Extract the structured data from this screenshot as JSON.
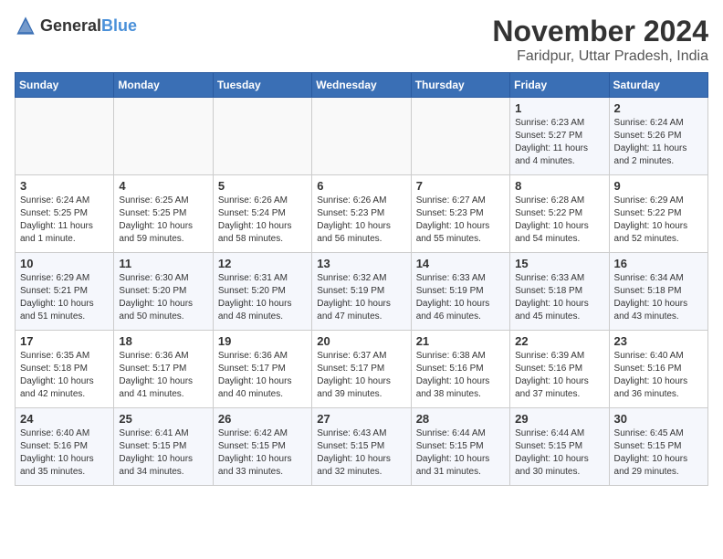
{
  "header": {
    "logo_general": "General",
    "logo_blue": "Blue",
    "month_title": "November 2024",
    "subtitle": "Faridpur, Uttar Pradesh, India"
  },
  "days_of_week": [
    "Sunday",
    "Monday",
    "Tuesday",
    "Wednesday",
    "Thursday",
    "Friday",
    "Saturday"
  ],
  "weeks": [
    [
      {
        "day": "",
        "info": ""
      },
      {
        "day": "",
        "info": ""
      },
      {
        "day": "",
        "info": ""
      },
      {
        "day": "",
        "info": ""
      },
      {
        "day": "",
        "info": ""
      },
      {
        "day": "1",
        "info": "Sunrise: 6:23 AM\nSunset: 5:27 PM\nDaylight: 11 hours and 4 minutes."
      },
      {
        "day": "2",
        "info": "Sunrise: 6:24 AM\nSunset: 5:26 PM\nDaylight: 11 hours and 2 minutes."
      }
    ],
    [
      {
        "day": "3",
        "info": "Sunrise: 6:24 AM\nSunset: 5:25 PM\nDaylight: 11 hours and 1 minute."
      },
      {
        "day": "4",
        "info": "Sunrise: 6:25 AM\nSunset: 5:25 PM\nDaylight: 10 hours and 59 minutes."
      },
      {
        "day": "5",
        "info": "Sunrise: 6:26 AM\nSunset: 5:24 PM\nDaylight: 10 hours and 58 minutes."
      },
      {
        "day": "6",
        "info": "Sunrise: 6:26 AM\nSunset: 5:23 PM\nDaylight: 10 hours and 56 minutes."
      },
      {
        "day": "7",
        "info": "Sunrise: 6:27 AM\nSunset: 5:23 PM\nDaylight: 10 hours and 55 minutes."
      },
      {
        "day": "8",
        "info": "Sunrise: 6:28 AM\nSunset: 5:22 PM\nDaylight: 10 hours and 54 minutes."
      },
      {
        "day": "9",
        "info": "Sunrise: 6:29 AM\nSunset: 5:22 PM\nDaylight: 10 hours and 52 minutes."
      }
    ],
    [
      {
        "day": "10",
        "info": "Sunrise: 6:29 AM\nSunset: 5:21 PM\nDaylight: 10 hours and 51 minutes."
      },
      {
        "day": "11",
        "info": "Sunrise: 6:30 AM\nSunset: 5:20 PM\nDaylight: 10 hours and 50 minutes."
      },
      {
        "day": "12",
        "info": "Sunrise: 6:31 AM\nSunset: 5:20 PM\nDaylight: 10 hours and 48 minutes."
      },
      {
        "day": "13",
        "info": "Sunrise: 6:32 AM\nSunset: 5:19 PM\nDaylight: 10 hours and 47 minutes."
      },
      {
        "day": "14",
        "info": "Sunrise: 6:33 AM\nSunset: 5:19 PM\nDaylight: 10 hours and 46 minutes."
      },
      {
        "day": "15",
        "info": "Sunrise: 6:33 AM\nSunset: 5:18 PM\nDaylight: 10 hours and 45 minutes."
      },
      {
        "day": "16",
        "info": "Sunrise: 6:34 AM\nSunset: 5:18 PM\nDaylight: 10 hours and 43 minutes."
      }
    ],
    [
      {
        "day": "17",
        "info": "Sunrise: 6:35 AM\nSunset: 5:18 PM\nDaylight: 10 hours and 42 minutes."
      },
      {
        "day": "18",
        "info": "Sunrise: 6:36 AM\nSunset: 5:17 PM\nDaylight: 10 hours and 41 minutes."
      },
      {
        "day": "19",
        "info": "Sunrise: 6:36 AM\nSunset: 5:17 PM\nDaylight: 10 hours and 40 minutes."
      },
      {
        "day": "20",
        "info": "Sunrise: 6:37 AM\nSunset: 5:17 PM\nDaylight: 10 hours and 39 minutes."
      },
      {
        "day": "21",
        "info": "Sunrise: 6:38 AM\nSunset: 5:16 PM\nDaylight: 10 hours and 38 minutes."
      },
      {
        "day": "22",
        "info": "Sunrise: 6:39 AM\nSunset: 5:16 PM\nDaylight: 10 hours and 37 minutes."
      },
      {
        "day": "23",
        "info": "Sunrise: 6:40 AM\nSunset: 5:16 PM\nDaylight: 10 hours and 36 minutes."
      }
    ],
    [
      {
        "day": "24",
        "info": "Sunrise: 6:40 AM\nSunset: 5:16 PM\nDaylight: 10 hours and 35 minutes."
      },
      {
        "day": "25",
        "info": "Sunrise: 6:41 AM\nSunset: 5:15 PM\nDaylight: 10 hours and 34 minutes."
      },
      {
        "day": "26",
        "info": "Sunrise: 6:42 AM\nSunset: 5:15 PM\nDaylight: 10 hours and 33 minutes."
      },
      {
        "day": "27",
        "info": "Sunrise: 6:43 AM\nSunset: 5:15 PM\nDaylight: 10 hours and 32 minutes."
      },
      {
        "day": "28",
        "info": "Sunrise: 6:44 AM\nSunset: 5:15 PM\nDaylight: 10 hours and 31 minutes."
      },
      {
        "day": "29",
        "info": "Sunrise: 6:44 AM\nSunset: 5:15 PM\nDaylight: 10 hours and 30 minutes."
      },
      {
        "day": "30",
        "info": "Sunrise: 6:45 AM\nSunset: 5:15 PM\nDaylight: 10 hours and 29 minutes."
      }
    ]
  ]
}
